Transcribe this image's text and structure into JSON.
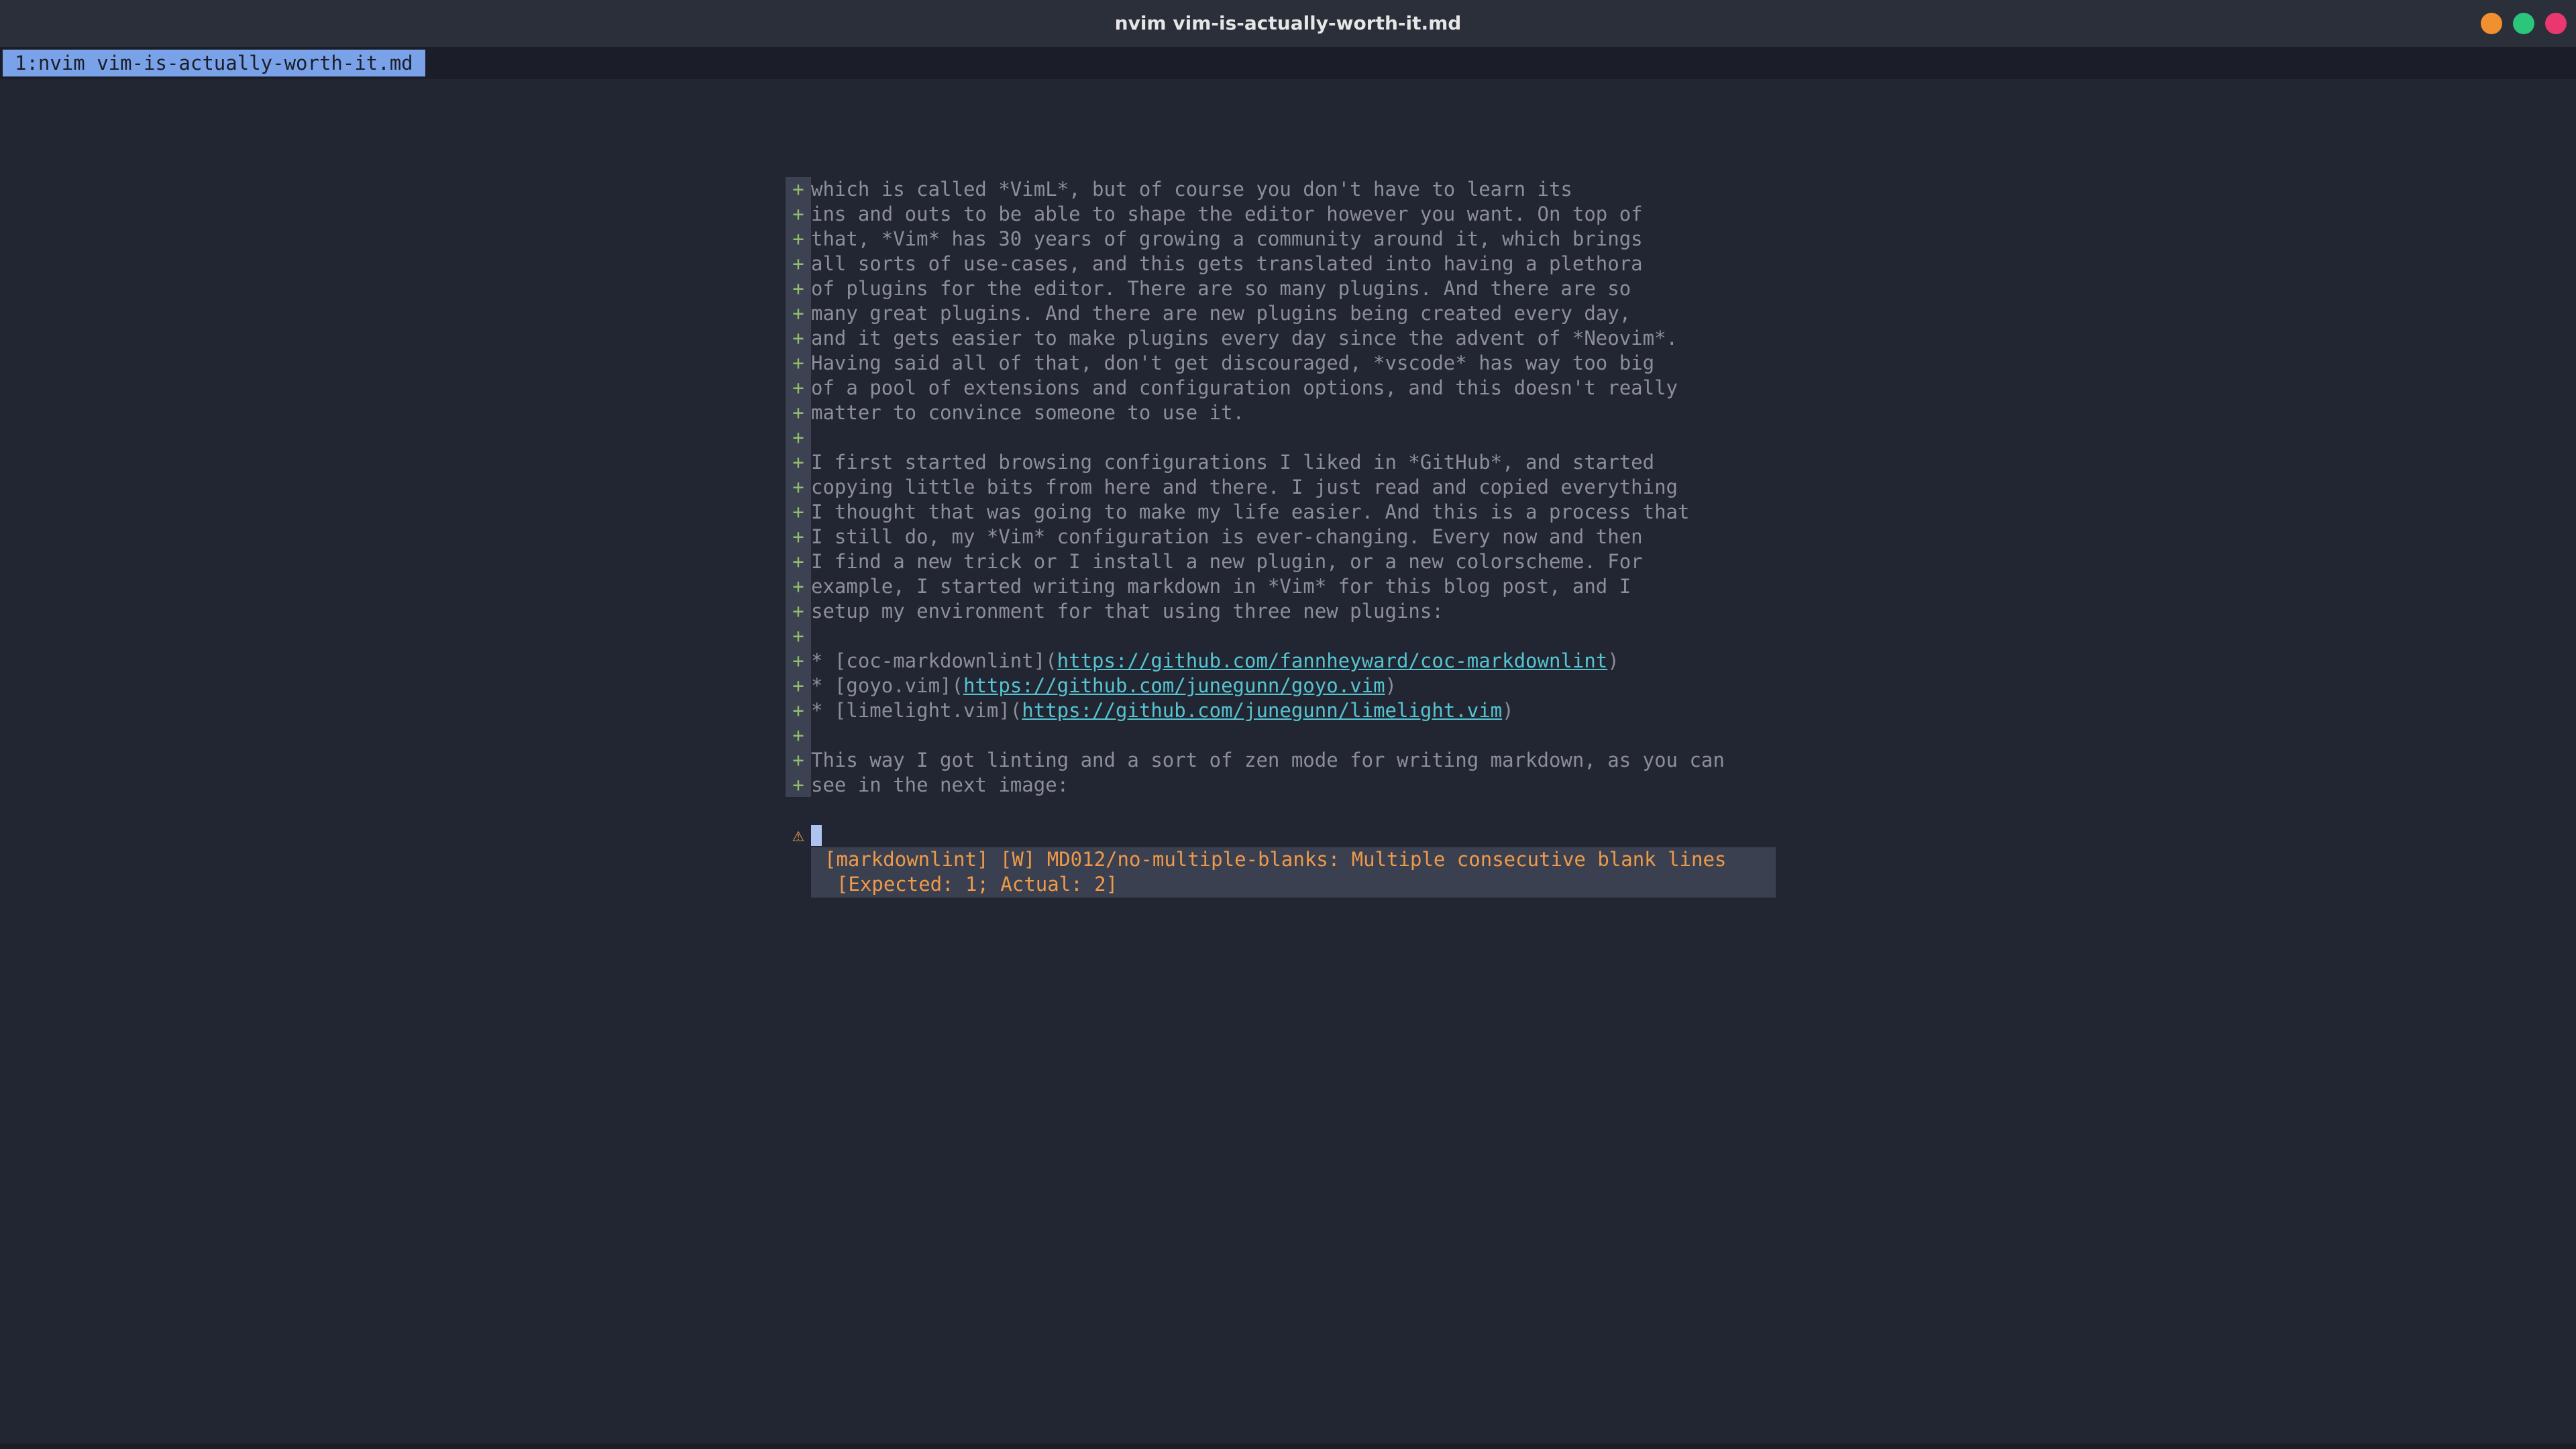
{
  "window": {
    "title": "nvim vim-is-actually-worth-it.md"
  },
  "tabline": {
    "active_tab": "1:nvim vim-is-actually-worth-it.md"
  },
  "editor": {
    "added_sign": "+",
    "warning_sign": "⚠",
    "lines": [
      "which is called *VimL*, but of course you don't have to learn its",
      "ins and outs to be able to shape the editor however you want. On top of",
      "that, *Vim* has 30 years of growing a community around it, which brings",
      "all sorts of use-cases, and this gets translated into having a plethora",
      "of plugins for the editor. There are so many plugins. And there are so",
      "many great plugins. And there are new plugins being created every day,",
      "and it gets easier to make plugins every day since the advent of *Neovim*.",
      "Having said all of that, don't get discouraged, *vscode* has way too big",
      "of a pool of extensions and configuration options, and this doesn't really",
      "matter to convince someone to use it.",
      "",
      "I first started browsing configurations I liked in *GitHub*, and started",
      "copying little bits from here and there. I just read and copied everything",
      "I thought that was going to make my life easier. And this is a process that",
      "I still do, my *Vim* configuration is ever-changing. Every now and then",
      "I find a new trick or I install a new plugin, or a new colorscheme. For",
      "example, I started writing markdown in *Vim* for this blog post, and I",
      "setup my environment for that using three new plugins:",
      ""
    ],
    "plugin_links": [
      {
        "prefix": "* [coc-markdownlint](",
        "url": "https://github.com/fannheyward/coc-markdownlint",
        "suffix": ")"
      },
      {
        "prefix": "* [goyo.vim](",
        "url": "https://github.com/junegunn/goyo.vim",
        "suffix": ")"
      },
      {
        "prefix": "* [limelight.vim](",
        "url": "https://github.com/junegunn/limelight.vim",
        "suffix": ")"
      }
    ],
    "after_lines": [
      "",
      "This way I got linting and a sort of zen mode for writing markdown, as you can",
      "see in the next image:"
    ]
  },
  "diagnostic": {
    "line1": "[markdownlint] [W] MD012/no-multiple-blanks: Multiple consecutive blank lines",
    "line2": "[Expected: 1; Actual: 2]"
  },
  "colors": {
    "background": "#222632",
    "added_sign": "#8fbf6a",
    "warning": "#e8a345",
    "link": "#56c4d1",
    "tab_active": "#7aa2e8"
  }
}
